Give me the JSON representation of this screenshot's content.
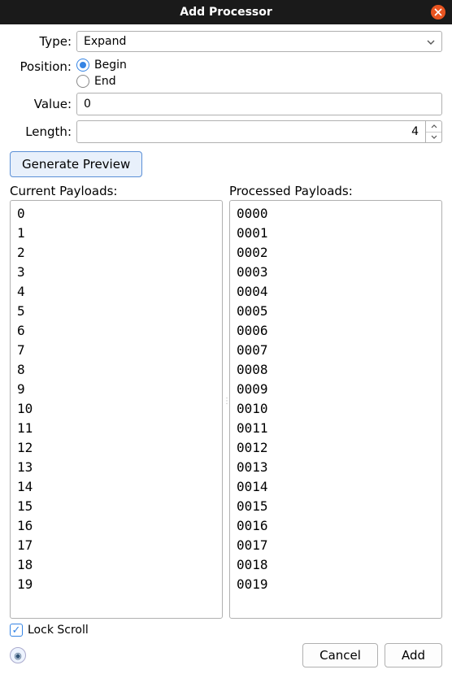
{
  "window": {
    "title": "Add Processor"
  },
  "form": {
    "typeLabel": "Type:",
    "typeValue": "Expand",
    "positionLabel": "Position:",
    "positionOptions": {
      "begin": "Begin",
      "end": "End"
    },
    "positionSelected": "begin",
    "valueLabel": "Value:",
    "valueText": "0",
    "lengthLabel": "Length:",
    "lengthValue": "4"
  },
  "buttons": {
    "generate": "Generate Preview",
    "cancel": "Cancel",
    "add": "Add"
  },
  "columns": {
    "currentHeader": "Current Payloads:",
    "processedHeader": "Processed Payloads:"
  },
  "currentPayloads": [
    "0",
    "1",
    "2",
    "3",
    "4",
    "5",
    "6",
    "7",
    "8",
    "9",
    "10",
    "11",
    "12",
    "13",
    "14",
    "15",
    "16",
    "17",
    "18",
    "19"
  ],
  "processedPayloads": [
    "0000",
    "0001",
    "0002",
    "0003",
    "0004",
    "0005",
    "0006",
    "0007",
    "0008",
    "0009",
    "0010",
    "0011",
    "0012",
    "0013",
    "0014",
    "0015",
    "0016",
    "0017",
    "0018",
    "0019"
  ],
  "lockScroll": {
    "label": "Lock Scroll",
    "checked": true
  }
}
